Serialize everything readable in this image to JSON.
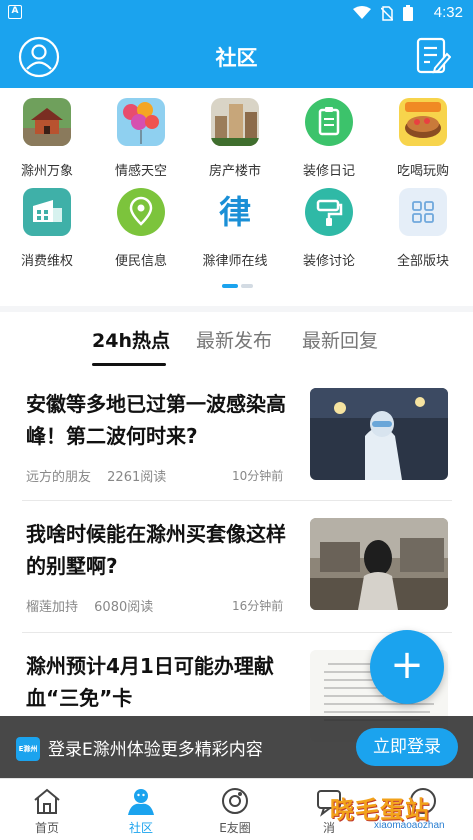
{
  "status_bar": {
    "time": "4:32",
    "badge": "A"
  },
  "header": {
    "title": "社区"
  },
  "boards": [
    {
      "label": "滁州万象",
      "icon": "pagoda-photo-icon"
    },
    {
      "label": "情感天空",
      "icon": "balloons-photo-icon"
    },
    {
      "label": "房产楼市",
      "icon": "buildings-photo-icon"
    },
    {
      "label": "装修日记",
      "icon": "clipboard-icon",
      "color": "#3cc36b"
    },
    {
      "label": "吃喝玩购",
      "icon": "food-photo-icon"
    },
    {
      "label": "消费维权",
      "icon": "shield-building-icon",
      "color": "#3fb0a8"
    },
    {
      "label": "便民信息",
      "icon": "location-pin-icon",
      "color": "#7cc43c"
    },
    {
      "label": "滁律师在线",
      "icon": "lawyer-icon",
      "glyph": "律"
    },
    {
      "label": "装修讨论",
      "icon": "paint-roller-icon",
      "color": "#2fb9a6"
    },
    {
      "label": "全部版块",
      "icon": "grid-icon",
      "color": "#e5eef8"
    }
  ],
  "feed": {
    "tabs": [
      {
        "label": "24h热点",
        "active": true
      },
      {
        "label": "最新发布",
        "active": false
      },
      {
        "label": "最新回复",
        "active": false
      }
    ],
    "articles": [
      {
        "title": "安徽等多地已过第一波感染高峰！第二波何时来?",
        "author": "远方的朋友",
        "reads": "2261阅读",
        "time": "10分钟前"
      },
      {
        "title": "我啥时候能在滁州买套像这样的别墅啊?",
        "author": "榴莲加持",
        "reads": "6080阅读",
        "time": "16分钟前"
      },
      {
        "title": "滁州预计4月1日可能办理献血“三免”卡",
        "author": "",
        "reads": "",
        "time": ""
      }
    ]
  },
  "fab": {
    "label": "+"
  },
  "login_prompt": {
    "logo_text": "E滁州",
    "text": "登录E滁州体验更多精彩内容",
    "button": "立即登录"
  },
  "tabbar": [
    {
      "label": "首页",
      "icon": "home-icon",
      "active": false
    },
    {
      "label": "社区",
      "icon": "community-icon",
      "active": true
    },
    {
      "label": "E友圈",
      "icon": "planet-icon",
      "active": false
    },
    {
      "label": "消",
      "icon": "message-icon",
      "active": false
    },
    {
      "label": "",
      "icon": "profile-icon",
      "active": false
    }
  ],
  "watermark": {
    "text": "晓毛蛋站",
    "sub": "xiaomaoaozhan"
  },
  "colors": {
    "brand": "#1ba3ee"
  }
}
